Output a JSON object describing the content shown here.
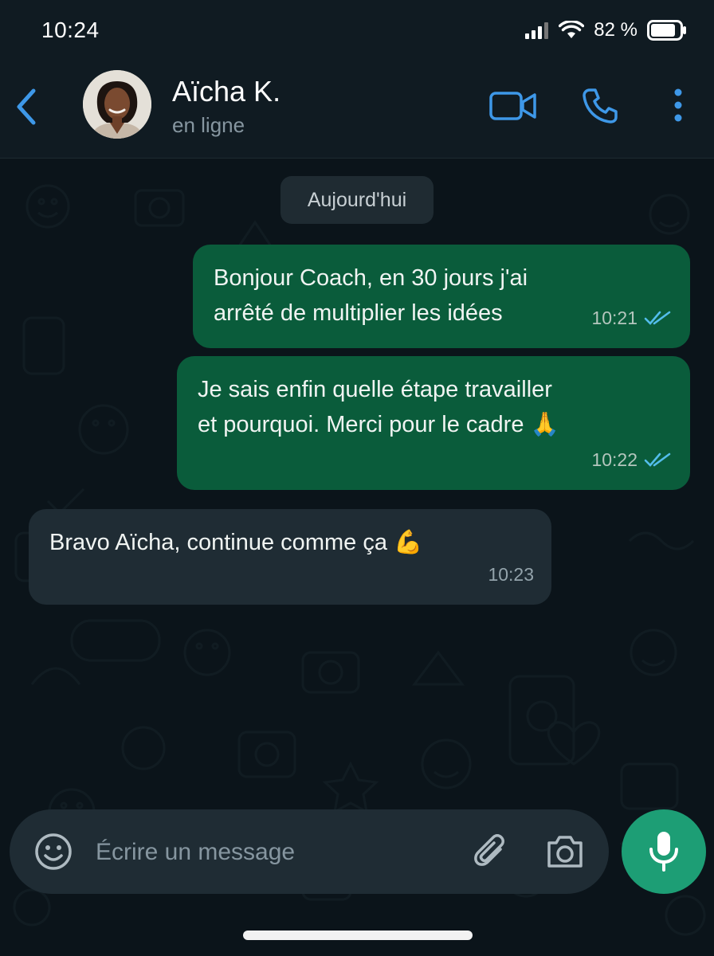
{
  "status_bar": {
    "time": "10:24",
    "battery": "82 %"
  },
  "header": {
    "name": "Aïcha K.",
    "status": "en ligne"
  },
  "date_chip": "Aujourd'hui",
  "messages": [
    {
      "direction": "out",
      "lines": [
        "Bonjour Coach, en 30 jours j'ai",
        "arrêté de multiplier les idées"
      ],
      "time": "10:21",
      "read": true
    },
    {
      "direction": "out",
      "lines": [
        "Je sais enfin quelle étape travailler",
        "et pourquoi. Merci pour le cadre 🙏"
      ],
      "time": "10:22",
      "read": true
    },
    {
      "direction": "in",
      "lines": [
        "Bravo Aïcha, continue comme ça 💪"
      ],
      "time": "10:23"
    }
  ],
  "composer": {
    "placeholder": "Écrire un message",
    "value": ""
  },
  "colors": {
    "accent": "#3e98e8",
    "outgoing_bubble": "#0a5c3b",
    "incoming_bubble": "#1f2c34",
    "mic_button": "#1d9e75",
    "read_ticks": "#53bdeb"
  },
  "icons": [
    "back-chevron-icon",
    "video-call-icon",
    "phone-icon",
    "more-vertical-icon",
    "emoji-icon",
    "paperclip-icon",
    "camera-icon",
    "microphone-icon",
    "signal-icon",
    "wifi-icon",
    "battery-icon",
    "double-check-icon"
  ]
}
